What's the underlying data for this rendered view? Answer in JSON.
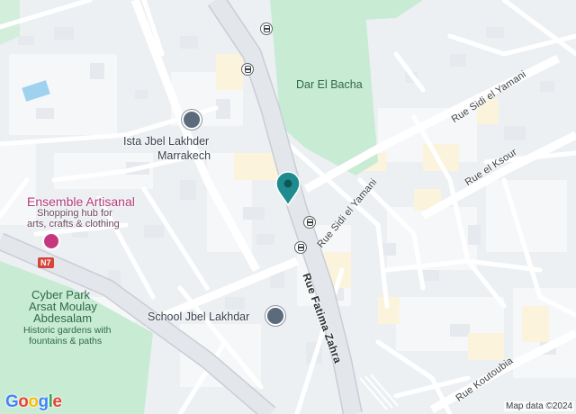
{
  "map": {
    "type": "street-map",
    "colors": {
      "background": "#edf0f3",
      "block": "#f5f6f8",
      "road": "#ffffff",
      "road_edge": "#c9ced6",
      "main_road": "#dfe3e8",
      "park": "#c8ebd4",
      "water": "#9fd2ee",
      "pin": "#1e8c8f",
      "shop": "#c5387f",
      "shield": "#d6453d"
    }
  },
  "places": {
    "dar_el_bacha": "Dar El Bacha",
    "ista_line1": "Ista Jbel Lakhder",
    "ista_line2": "Marrakech",
    "ensemble_title": "Ensemble Artisanal",
    "ensemble_desc1": "Shopping hub for",
    "ensemble_desc2": "arts, crafts & clothing",
    "cyber_line1": "Cyber Park",
    "cyber_line2": "Arsat Moulay",
    "cyber_line3": "Abdesalam",
    "cyber_desc1": "Historic gardens with",
    "cyber_desc2": "fountains & paths",
    "school": "School Jbel Lakhdar"
  },
  "streets": {
    "sidi_el_yamani_1": "Rue Sidi el Yamani",
    "sidi_el_yamani_2": "Rue Sidi el Yamani",
    "el_ksour": "Rue el Ksour",
    "fatima_zahra": "Rue Fatima Zahra",
    "koutoubia": "Rue Koutoubia",
    "route_n7": "N7"
  },
  "icons": {
    "bus": "bus-stop-icon",
    "school": "school-icon",
    "shop": "shopping-bag-icon",
    "pin": "location-pin-icon"
  },
  "footer": {
    "logo": [
      "G",
      "o",
      "o",
      "g",
      "l",
      "e"
    ],
    "logo_colors": [
      "#4285f4",
      "#ea4335",
      "#fbbc05",
      "#4285f4",
      "#34a853",
      "#ea4335"
    ],
    "attribution": "Map data ©2024"
  }
}
